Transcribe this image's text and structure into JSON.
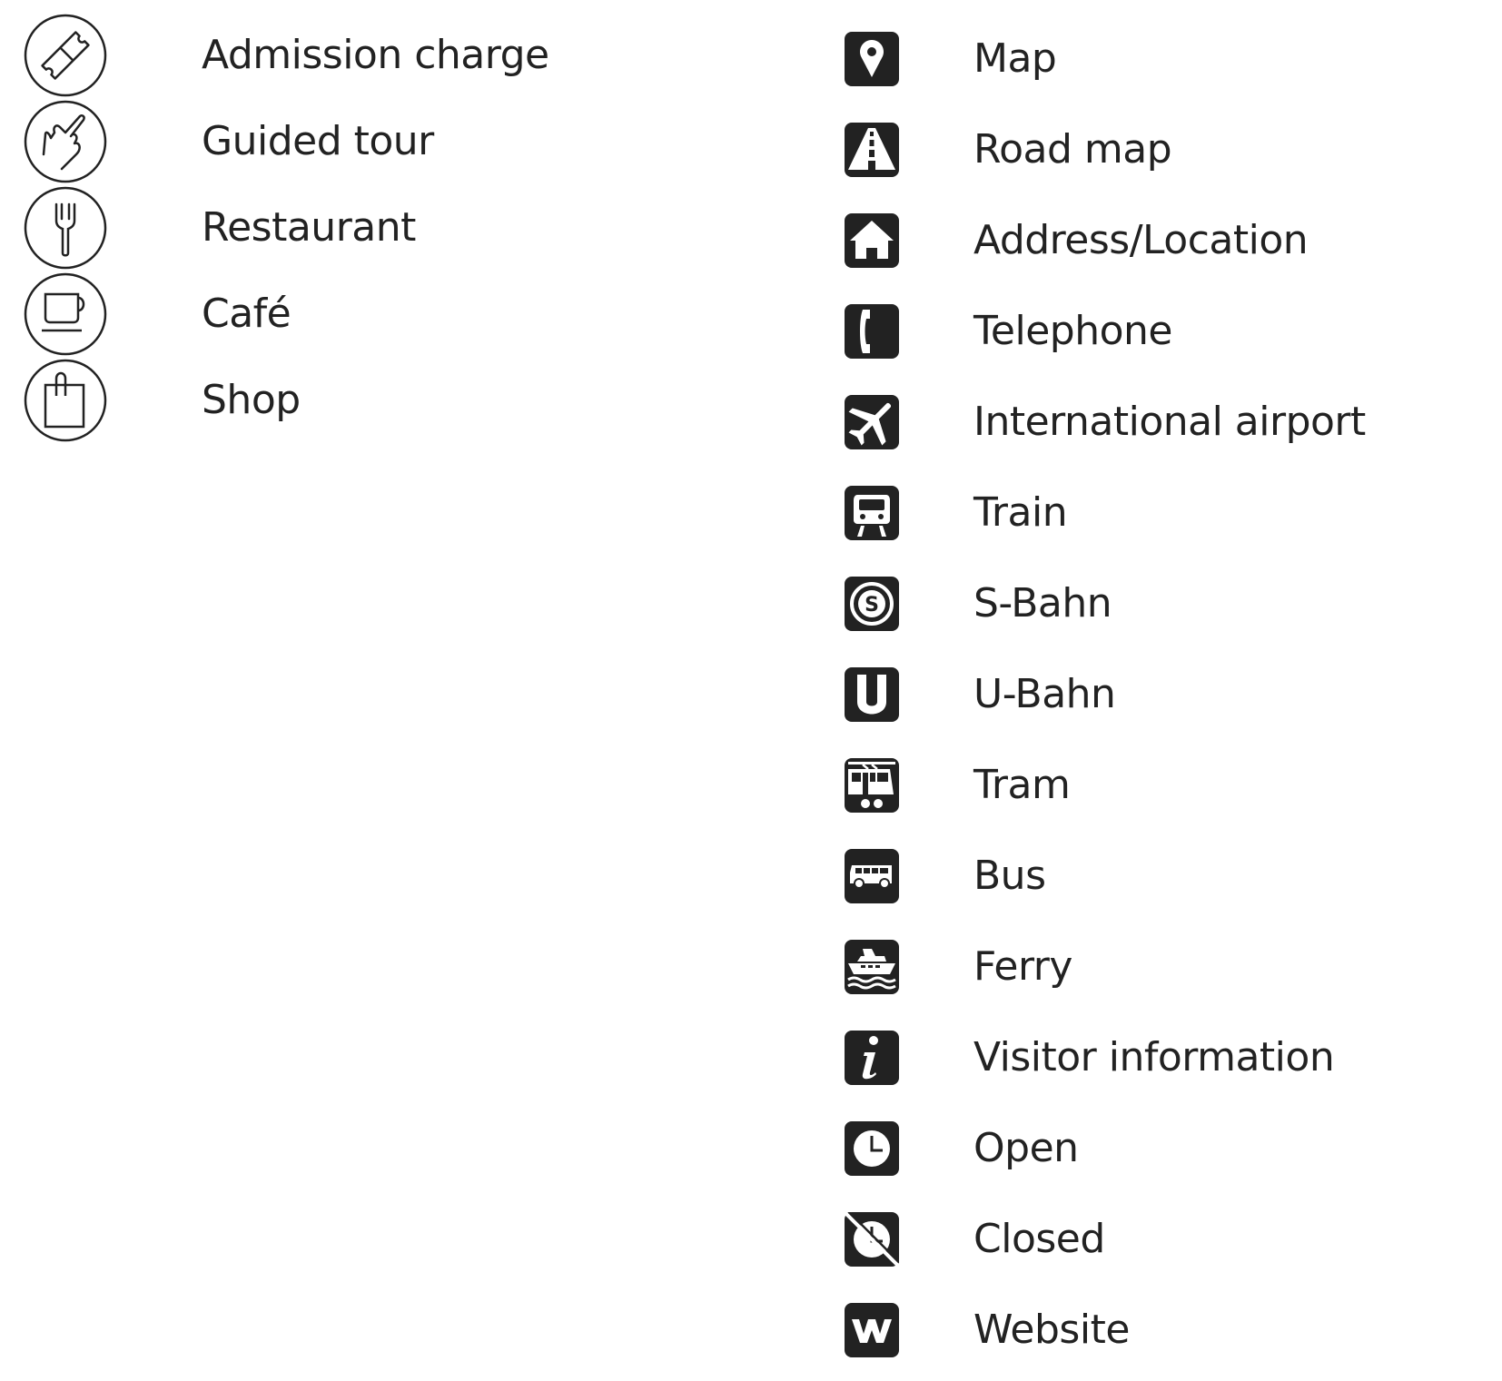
{
  "legend_left": {
    "items": [
      {
        "label": "Admission charge",
        "icon": "ticket-icon"
      },
      {
        "label": "Guided tour",
        "icon": "pointing-hand-icon"
      },
      {
        "label": "Restaurant",
        "icon": "fork-icon"
      },
      {
        "label": "Café",
        "icon": "coffee-cup-icon"
      },
      {
        "label": "Shop",
        "icon": "shopping-bag-icon"
      }
    ]
  },
  "legend_right": {
    "items": [
      {
        "label": "Map",
        "icon": "map-pin-icon"
      },
      {
        "label": "Road map",
        "icon": "road-icon"
      },
      {
        "label": "Address/Location",
        "icon": "house-icon"
      },
      {
        "label": "Telephone",
        "icon": "telephone-icon"
      },
      {
        "label": "International airport",
        "icon": "airplane-icon"
      },
      {
        "label": "Train",
        "icon": "train-icon"
      },
      {
        "label": "S-Bahn",
        "icon": "s-bahn-icon"
      },
      {
        "label": "U-Bahn",
        "icon": "u-bahn-icon"
      },
      {
        "label": "Tram",
        "icon": "tram-icon"
      },
      {
        "label": "Bus",
        "icon": "bus-icon"
      },
      {
        "label": "Ferry",
        "icon": "ferry-icon"
      },
      {
        "label": "Visitor information",
        "icon": "info-icon"
      },
      {
        "label": "Open",
        "icon": "clock-icon"
      },
      {
        "label": "Closed",
        "icon": "clock-crossed-icon"
      },
      {
        "label": "Website",
        "icon": "website-w-icon"
      }
    ]
  },
  "colors": {
    "ink": "#222222",
    "background": "#ffffff"
  }
}
